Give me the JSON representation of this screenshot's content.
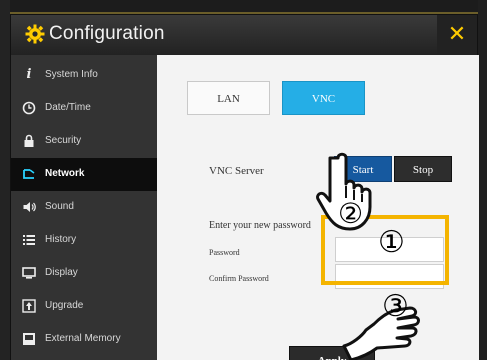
{
  "window": {
    "title": "Configuration",
    "close_glyph": "✕"
  },
  "sidebar": {
    "items": [
      {
        "label": "System Info",
        "icon": "info-icon"
      },
      {
        "label": "Date/Time",
        "icon": "clock-icon"
      },
      {
        "label": "Security",
        "icon": "lock-icon"
      },
      {
        "label": "Network",
        "icon": "network-icon",
        "active": true
      },
      {
        "label": "Sound",
        "icon": "speaker-icon"
      },
      {
        "label": "History",
        "icon": "list-icon"
      },
      {
        "label": "Display",
        "icon": "monitor-icon"
      },
      {
        "label": "Upgrade",
        "icon": "upgrade-icon"
      },
      {
        "label": "External Memory",
        "icon": "memory-icon"
      }
    ]
  },
  "tabs": [
    {
      "label": "LAN"
    },
    {
      "label": "VNC",
      "active": true
    }
  ],
  "vnc": {
    "server_label": "VNC Server",
    "start_label": "Start",
    "stop_label": "Stop",
    "password_prompt": "Enter your new password",
    "password_label": "Password",
    "confirm_password_label": "Confirm Password",
    "password_value": "",
    "confirm_password_value": "",
    "apply_label": "Apply"
  },
  "annotations": {
    "step1": "①",
    "step2": "②",
    "step3": "③"
  },
  "colors": {
    "accent_blue": "#25aee6",
    "start_blue": "#16599f",
    "highlight": "#f4b400",
    "active_icon": "#2ad3ff"
  }
}
